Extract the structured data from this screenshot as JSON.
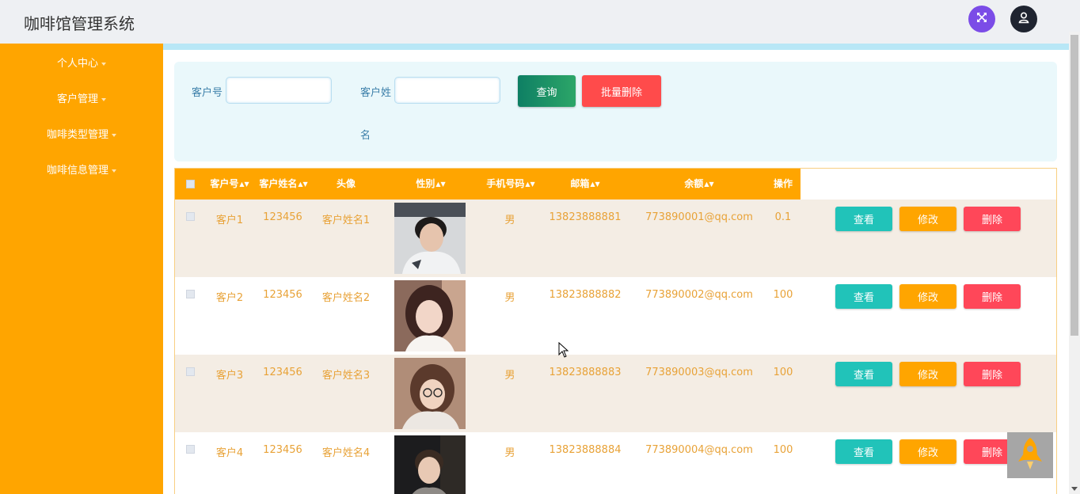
{
  "header": {
    "title": "咖啡馆管理系统"
  },
  "sidebar": {
    "items": [
      {
        "label": "个人中心"
      },
      {
        "label": "客户管理"
      },
      {
        "label": "咖啡类型管理"
      },
      {
        "label": "咖啡信息管理"
      }
    ]
  },
  "search": {
    "customer_no_label": "客户号",
    "customer_no_value": "",
    "customer_name_label_line1": "客户姓",
    "customer_name_label_line2": "名",
    "customer_name_value": "",
    "query_button": "查询",
    "batch_delete_button": "批量删除"
  },
  "table": {
    "headers": [
      "客户号",
      "客户姓名",
      "头像",
      "性别",
      "手机号码",
      "邮箱",
      "余额",
      "操作"
    ],
    "rows": [
      {
        "customer_no": "客户1",
        "password": "123456",
        "name": "客户姓名1",
        "gender": "男",
        "phone": "13823888881",
        "email": "773890001@qq.com",
        "balance": "0.1"
      },
      {
        "customer_no": "客户2",
        "password": "123456",
        "name": "客户姓名2",
        "gender": "男",
        "phone": "13823888882",
        "email": "773890002@qq.com",
        "balance": "100"
      },
      {
        "customer_no": "客户3",
        "password": "123456",
        "name": "客户姓名3",
        "gender": "男",
        "phone": "13823888883",
        "email": "773890003@qq.com",
        "balance": "100"
      },
      {
        "customer_no": "客户4",
        "password": "123456",
        "name": "客户姓名4",
        "gender": "男",
        "phone": "13823888884",
        "email": "773890004@qq.com",
        "balance": "100"
      }
    ],
    "actions": {
      "view": "查看",
      "edit": "修改",
      "delete": "删除"
    }
  },
  "colors": {
    "accent": "#ffa500",
    "view_button": "#21c3b9",
    "delete_button": "#ff4759",
    "query_button": "#1a8f66",
    "text_highlight": "#e8a237"
  },
  "icons": {
    "fullscreen": "expand-icon",
    "user": "user-icon",
    "back_to_top": "rocket-icon"
  }
}
